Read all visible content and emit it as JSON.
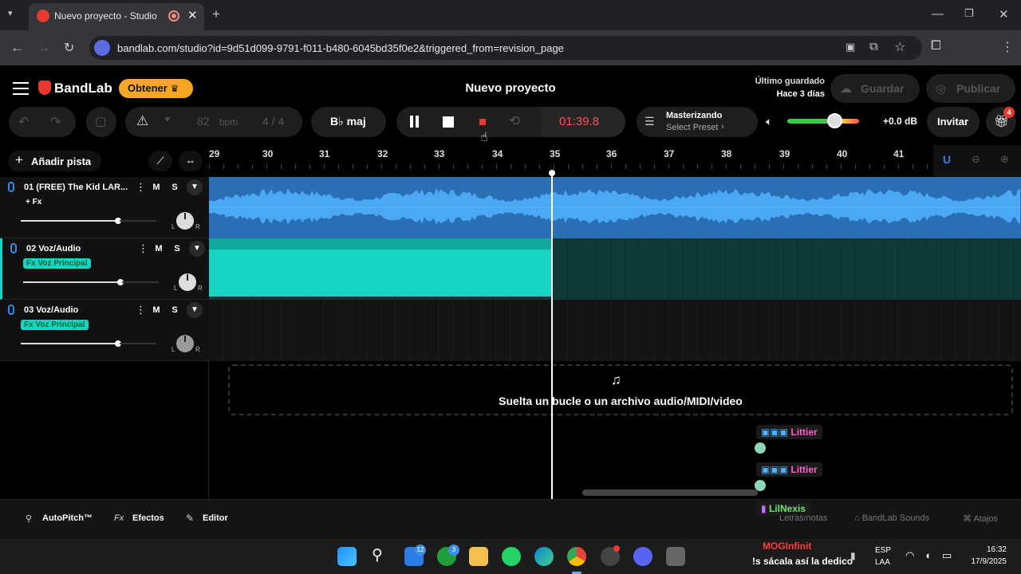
{
  "browser": {
    "tab_title": "Nuevo proyecto - Studio",
    "tab_close": "✕",
    "new_tab": "+",
    "url": "bandlab.com/studio?id=9d51d099-9791-f011-b480-6045bd35f0e2&triggered_from=revision_page"
  },
  "header": {
    "logo": "BandLab",
    "obtener": "Obtener",
    "project_title": "Nuevo proyecto",
    "last_saved_label": "Último guardado",
    "last_saved_value": "Hace 3 días",
    "guardar": "Guardar",
    "publicar": "Publicar"
  },
  "toolbar": {
    "bpm_value": "82",
    "bpm_label": "bpm",
    "time_signature": "4 / 4",
    "key": "B♭ maj",
    "time": "01:39.8",
    "mastering_title": "Masterizando",
    "mastering_preset": "Select Preset",
    "volume_db": "+0.0 dB",
    "invite": "Invitar",
    "gift_badge": "4"
  },
  "tracks_panel": {
    "add_track": "Añadir pista"
  },
  "ruler": {
    "ticks": [
      "29",
      "30",
      "31",
      "32",
      "33",
      "34",
      "35",
      "36",
      "37",
      "38",
      "39",
      "40",
      "41"
    ]
  },
  "tracks": [
    {
      "name": "01  (FREE) The Kid LAR...",
      "fx": "+ Fx",
      "mute": "M",
      "solo": "S",
      "pan_l": "L",
      "pan_r": "R"
    },
    {
      "name": "02  Voz/Audio",
      "fx": "Fx Voz Principal",
      "mute": "M",
      "solo": "S",
      "pan_l": "L",
      "pan_r": "R"
    },
    {
      "name": "03  Voz/Audio",
      "fx": "Fx Voz Principal",
      "mute": "M",
      "solo": "S",
      "pan_l": "L",
      "pan_r": "R"
    }
  ],
  "dropzone": {
    "text": "Suelta un bucle o un archivo audio/MIDI/video"
  },
  "bottom": {
    "autopitch": "AutoPitch™",
    "efectos_prefix": "Fx",
    "efectos": "Efectos",
    "editor": "Editor",
    "letras": "Letras/notas",
    "sounds": "BandLab Sounds",
    "atajos": "Atajos"
  },
  "chat_overlay": [
    {
      "user": "Littier",
      "color": "#ff5ec8"
    },
    {
      "user": "Littier",
      "color": "#ff5ec8"
    },
    {
      "user": "LilNexis",
      "color": "#6fe36f"
    },
    {
      "user": "MOGInfinit",
      "color": "#ff3b3b"
    }
  ],
  "chat_message": "!s sácala así la dedico",
  "taskbar": {
    "lang": "ESP",
    "lang_sub": "LAA",
    "time": "16:32",
    "date": "17/9/2025",
    "badge_mail": "12",
    "badge_xbox": "3"
  },
  "colors": {
    "accent_orange": "#f5a623",
    "record_red": "#e8392e",
    "track1_wave": "#3a9be6",
    "track2_clip": "#17d4c4",
    "time_red": "#ff4d5a"
  }
}
